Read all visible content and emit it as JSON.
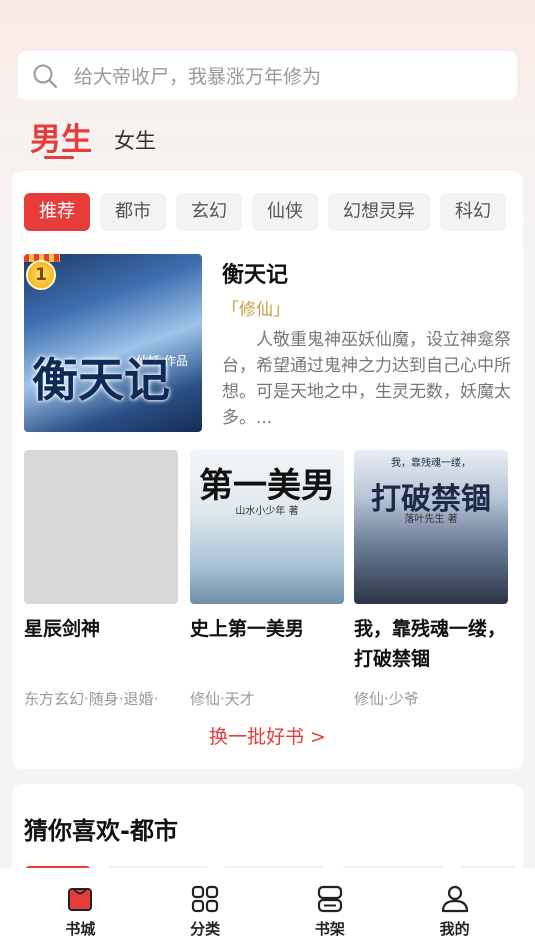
{
  "search": {
    "placeholder": "给大帝收尸，我暴涨万年修为"
  },
  "gender_tabs": {
    "male": "男生",
    "female": "女生"
  },
  "category_tabs": [
    "推荐",
    "都市",
    "玄幻",
    "仙侠",
    "幻想灵异",
    "科幻"
  ],
  "featured": {
    "rank": "1",
    "title": "衡天记",
    "tag": "「修仙」",
    "description": "人敬重鬼神巫妖仙魔，设立神龛祭台，希望通过鬼神之力达到自己心中所想。可是天地之中，生灵无数，妖魔太多。...",
    "cover_title": "衡天记",
    "cover_author": "仙妖·作品"
  },
  "books": [
    {
      "name": "星辰剑神",
      "meta": "东方玄幻·随身·退婚·"
    },
    {
      "name": "史上第一美男",
      "meta": "修仙·天才",
      "cover_title": "第一美男",
      "cover_author": "山水小少年 著"
    },
    {
      "name": "我，靠残魂一缕，打破禁锢",
      "meta": "修仙·少爷",
      "cover_top": "我，靠残魂一缕，",
      "cover_title": "打破禁锢",
      "cover_author": "落叶先生 著"
    }
  ],
  "refresh_label": "换一批好书 >",
  "guess_section": {
    "title": "猜你喜欢-都市"
  },
  "bottom_nav": [
    {
      "label": "书城",
      "icon": "bookstore-icon",
      "active": true
    },
    {
      "label": "分类",
      "icon": "category-grid-icon",
      "active": false
    },
    {
      "label": "书架",
      "icon": "bookshelf-icon",
      "active": false
    },
    {
      "label": "我的",
      "icon": "profile-icon",
      "active": false
    }
  ],
  "colors": {
    "accent": "#e63d3a",
    "tag_gold": "#c9a04a"
  }
}
